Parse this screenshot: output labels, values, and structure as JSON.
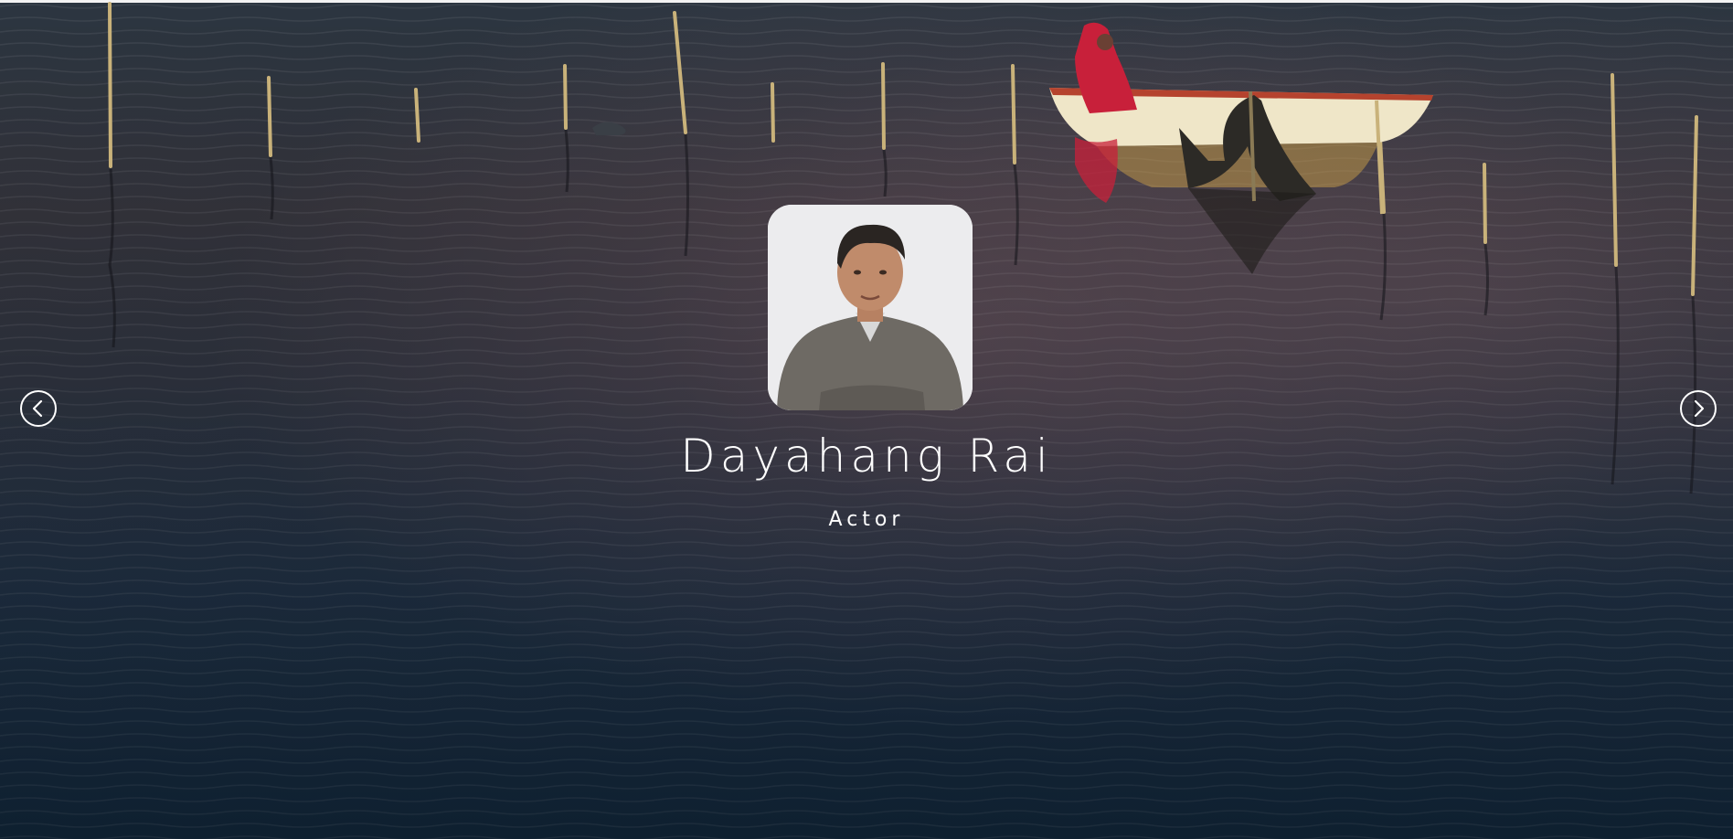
{
  "profile": {
    "name": "Dayahang Rai",
    "role": "Actor"
  },
  "carousel": {
    "prev_icon": "chevron-left-icon",
    "next_icon": "chevron-right-icon"
  },
  "colors": {
    "text": "#ffffff",
    "water_top": "#2b3540",
    "water_bottom": "#132a40",
    "boat": "#efe6c8",
    "boat_trim": "#b5432e",
    "figure": "#c8203a"
  }
}
